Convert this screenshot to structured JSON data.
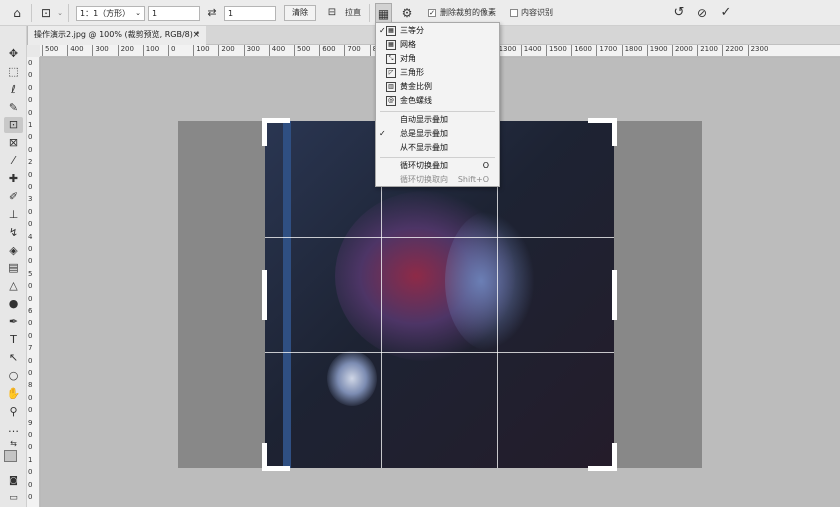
{
  "options_bar": {
    "ratio_select": "1：1（方形）",
    "ratio_width": "1",
    "ratio_height": "1",
    "clear_label": "清除",
    "straighten_label": "拉直",
    "delete_cropped_label": "删除裁剪的像素",
    "content_aware_label": "内容识别"
  },
  "tab": {
    "title": "操作演示2.jpg @ 100% (裁剪预览, RGB/8) *",
    "close": "×"
  },
  "ruler_top": [
    "500",
    "400",
    "300",
    "200",
    "100",
    "0",
    "100",
    "200",
    "300",
    "400",
    "500",
    "600",
    "700",
    "800",
    "900",
    "1000",
    "1100",
    "1200",
    "1300",
    "1400",
    "1500",
    "1600",
    "1700",
    "1800",
    "1900",
    "2000",
    "2100",
    "2200",
    "2300"
  ],
  "ruler_left": [
    "0",
    "0",
    "0",
    "0",
    "0",
    "1",
    "0",
    "0",
    "2",
    "0",
    "0",
    "3",
    "0",
    "0",
    "4",
    "0",
    "0",
    "5",
    "0",
    "0",
    "6",
    "0",
    "0",
    "7",
    "0",
    "0",
    "8",
    "0",
    "0",
    "9",
    "0",
    "0",
    "1",
    "0",
    "0",
    "0"
  ],
  "overlay_menu": {
    "items": [
      {
        "label": "三等分",
        "checked": true,
        "icon": "thirds-grid-icon"
      },
      {
        "label": "网格",
        "checked": false,
        "icon": "grid-icon"
      },
      {
        "label": "对角",
        "checked": false,
        "icon": "diagonal-icon"
      },
      {
        "label": "三角形",
        "checked": false,
        "icon": "triangle-icon"
      },
      {
        "label": "黄金比例",
        "checked": false,
        "icon": "golden-ratio-icon"
      },
      {
        "label": "金色螺线",
        "checked": false,
        "icon": "golden-spiral-icon"
      }
    ],
    "display_options": [
      {
        "label": "自动显示叠加",
        "checked": false
      },
      {
        "label": "总是显示叠加",
        "checked": true
      },
      {
        "label": "从不显示叠加",
        "checked": false
      }
    ],
    "cycle": [
      {
        "label": "循环切换叠加",
        "shortcut": "O",
        "disabled": false
      },
      {
        "label": "循环切换取向",
        "shortcut": "Shift+O",
        "disabled": true
      }
    ]
  }
}
